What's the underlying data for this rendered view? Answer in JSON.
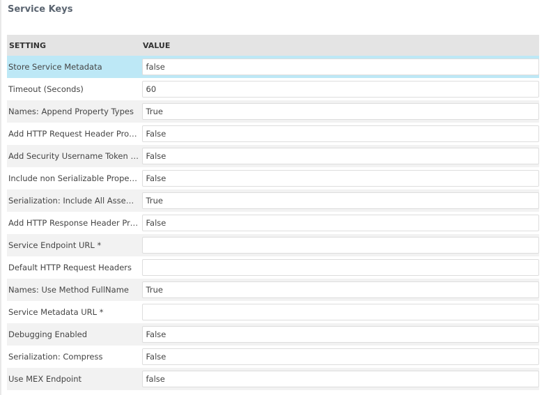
{
  "title": "Service Keys",
  "columns": {
    "setting": "SETTING",
    "value": "VALUE"
  },
  "rows": [
    {
      "label": "Store Service Metadata",
      "value": "false"
    },
    {
      "label": "Timeout (Seconds)",
      "value": "60"
    },
    {
      "label": "Names: Append Property Types",
      "value": "True"
    },
    {
      "label": "Add HTTP Request Header Prop...",
      "value": "False"
    },
    {
      "label": "Add Security Username Token T...",
      "value": "False"
    },
    {
      "label": "Include non Serializable Propert...",
      "value": "False"
    },
    {
      "label": "Serialization: Include All Assemb...",
      "value": "True"
    },
    {
      "label": "Add HTTP Response Header Pro...",
      "value": "False"
    },
    {
      "label": "Service Endpoint URL *",
      "value": ""
    },
    {
      "label": "Default HTTP Request Headers",
      "value": ""
    },
    {
      "label": "Names: Use Method FullName",
      "value": "True"
    },
    {
      "label": "Service Metadata URL *",
      "value": ""
    },
    {
      "label": "Debugging Enabled",
      "value": "False"
    },
    {
      "label": "Serialization: Compress",
      "value": "False"
    },
    {
      "label": "Use MEX Endpoint",
      "value": "false"
    }
  ]
}
